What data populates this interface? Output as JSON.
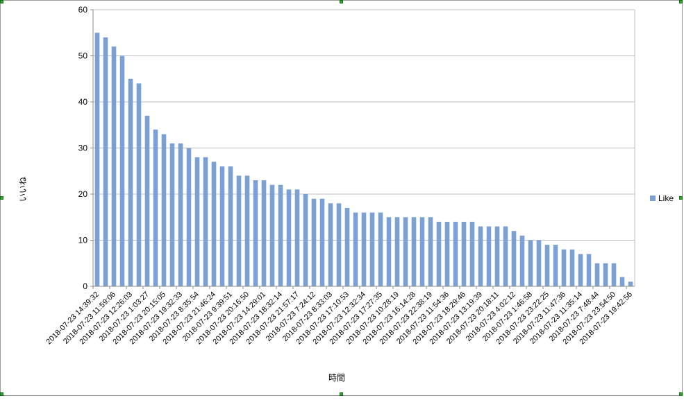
{
  "chart_data": {
    "type": "bar",
    "title": "",
    "xlabel": "時間",
    "ylabel": "いいね",
    "ylim": [
      0,
      60
    ],
    "yticks": [
      0,
      10,
      20,
      30,
      40,
      50,
      60
    ],
    "grid": true,
    "legend": "right",
    "bar_color": "#7aa0d4",
    "categories": [
      "2018-07-23 14:39:32",
      "",
      "2018-07-23 11:59:06",
      "",
      "2018-07-23 12:26:03",
      "",
      "2018-07-23 1:03:27",
      "",
      "2018-07-23 20:15:05",
      "",
      "2018-07-23 19:32:33",
      "",
      "2018-07-23 8:35:54",
      "",
      "2018-07-23 21:46:24",
      "",
      "2018-07-23 9:39:51",
      "",
      "2018-07-23 20:16:50",
      "",
      "2018-07-23 14:29:01",
      "",
      "2018-07-23 18:32:14",
      "",
      "2018-07-23 21:57:17",
      "",
      "2018-07-23 7:24:12",
      "",
      "2018-07-23 8:33:03",
      "",
      "2018-07-23 17:10:53",
      "",
      "2018-07-23 12:32:34",
      "",
      "2018-07-23 17:27:35",
      "",
      "2018-07-23 10:28:19",
      "",
      "2018-07-23 16:14:28",
      "",
      "2018-07-23 22:38:19",
      "",
      "2018-07-23 11:54:36",
      "",
      "2018-07-23 18:29:46",
      "",
      "2018-07-23 13:19:39",
      "",
      "2018-07-23 20:18:11",
      "",
      "2018-07-23 4:02:12",
      "",
      "2018-07-23 1:46:58",
      "",
      "2018-07-23 23:22:25",
      "",
      "2018-07-23 11:47:36",
      "",
      "2018-07-23 11:35:14",
      "",
      "2018-07-23 7:48:44",
      "",
      "2018-07-23 23:54:50",
      "",
      "2018-07-23 19:42:56",
      ""
    ],
    "series": [
      {
        "name": "Like",
        "values": [
          55,
          54,
          52,
          50,
          45,
          44,
          37,
          34,
          33,
          31,
          31,
          30,
          28,
          28,
          27,
          26,
          26,
          24,
          24,
          23,
          23,
          22,
          22,
          21,
          21,
          20,
          19,
          19,
          18,
          18,
          17,
          16,
          16,
          16,
          16,
          15,
          15,
          15,
          15,
          15,
          15,
          14,
          14,
          14,
          14,
          14,
          13,
          13,
          13,
          13,
          12,
          11,
          10,
          10,
          9,
          9,
          8,
          8,
          7,
          7,
          5,
          5,
          5,
          2,
          1
        ]
      }
    ]
  }
}
